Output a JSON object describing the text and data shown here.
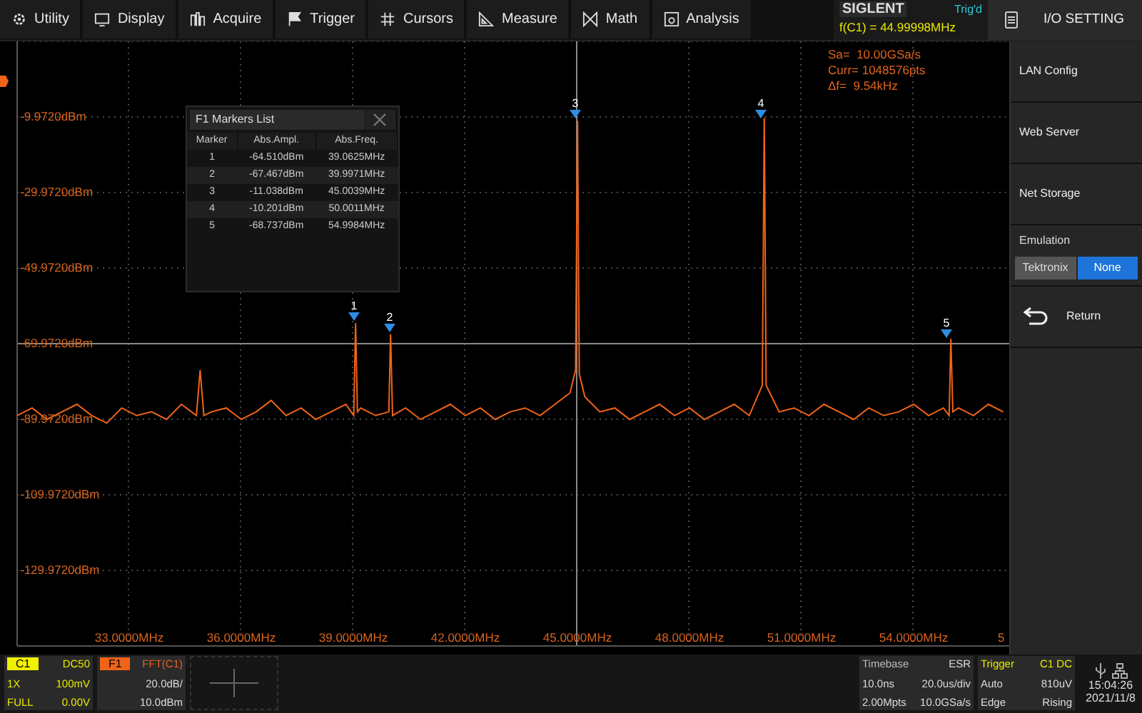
{
  "menu_bar": {
    "items": [
      {
        "label": "Utility"
      },
      {
        "label": "Display"
      },
      {
        "label": "Acquire"
      },
      {
        "label": "Trigger"
      },
      {
        "label": "Cursors"
      },
      {
        "label": "Measure"
      },
      {
        "label": "Math"
      },
      {
        "label": "Analysis"
      }
    ]
  },
  "header": {
    "brand": "SIGLENT",
    "trigger_status": "Trig'd",
    "frequency": "f(C1) = 44.99998MHz"
  },
  "plot": {
    "chart_data": {
      "type": "line",
      "grid": true,
      "xlim": [
        30,
        56.56
      ],
      "ylim": [
        -149.972,
        10.028
      ],
      "yticks": [
        {
          "value": -9.972,
          "label": "-9.9720dBm"
        },
        {
          "value": -29.972,
          "label": "-29.9720dBm"
        },
        {
          "value": -49.972,
          "label": "-49.9720dBm"
        },
        {
          "value": -69.972,
          "label": "-69.9720dBm"
        },
        {
          "value": -89.972,
          "label": "-89.9720dBm"
        },
        {
          "value": -109.972,
          "label": "-109.9720dBm"
        },
        {
          "value": -129.972,
          "label": "-129.9720dBm"
        }
      ],
      "xticks": [
        {
          "value": 33,
          "label": "33.0000MHz"
        },
        {
          "value": 36,
          "label": "36.0000MHz"
        },
        {
          "value": 39,
          "label": "39.0000MHz"
        },
        {
          "value": 42,
          "label": "42.0000MHz"
        },
        {
          "value": 45,
          "label": "45.0000MHz"
        },
        {
          "value": 48,
          "label": "48.0000MHz"
        },
        {
          "value": 51,
          "label": "51.0000MHz"
        },
        {
          "value": 54,
          "label": "54.0000MHz"
        }
      ],
      "x": [
        30.0,
        30.4,
        30.8,
        31.2,
        31.6,
        32.0,
        32.4,
        32.8,
        33.2,
        33.6,
        34.0,
        34.4,
        34.8,
        34.9,
        35.0,
        35.2,
        35.6,
        36.0,
        36.4,
        36.8,
        37.2,
        37.6,
        38.0,
        38.4,
        38.8,
        39.01,
        39.0625,
        39.11,
        39.2,
        39.6,
        39.95,
        39.9971,
        40.05,
        40.4,
        40.8,
        41.2,
        41.6,
        42.0,
        42.4,
        42.8,
        43.2,
        43.6,
        44.0,
        44.4,
        44.8,
        44.95,
        45.0039,
        45.05,
        45.2,
        45.6,
        46.0,
        46.4,
        46.8,
        47.2,
        47.6,
        48.0,
        48.4,
        48.8,
        49.2,
        49.6,
        49.95,
        50.0011,
        50.05,
        50.4,
        50.8,
        51.2,
        51.6,
        52.0,
        52.4,
        52.8,
        53.2,
        53.6,
        54.0,
        54.4,
        54.8,
        54.95,
        54.9984,
        55.05,
        55.2,
        55.6,
        56.0,
        56.4
      ],
      "series": [
        {
          "color": "#f06418",
          "values": [
            -89,
            -87,
            -90,
            -88,
            -86,
            -89,
            -91,
            -87,
            -89,
            -88,
            -90,
            -86,
            -89,
            -77,
            -89,
            -88,
            -87,
            -90,
            -88,
            -85,
            -89,
            -87,
            -90,
            -88,
            -86,
            -89,
            -64.5,
            -88,
            -87,
            -89,
            -88,
            -67.5,
            -89,
            -87,
            -90,
            -88,
            -86,
            -89,
            -87,
            -90,
            -88,
            -87,
            -89,
            -86,
            -83,
            -77,
            -11,
            -78,
            -84,
            -88,
            -87,
            -90,
            -88,
            -86,
            -89,
            -87,
            -90,
            -88,
            -86,
            -89,
            -81,
            -10.2,
            -81,
            -88,
            -87,
            -89,
            -86,
            -88,
            -90,
            -87,
            -89,
            -88,
            -86,
            -89,
            -87,
            -89,
            -68.7,
            -88,
            -87,
            -89,
            -86,
            -88
          ]
        }
      ]
    },
    "cut_x_label": "5",
    "readouts": [
      "Sa=  10.00GSa/s",
      "Curr= 1048576pts",
      "Δf=  9.54kHz"
    ],
    "markers": [
      {
        "label": "1"
      },
      {
        "label": "2"
      },
      {
        "label": "3"
      },
      {
        "label": "4"
      },
      {
        "label": "5"
      }
    ]
  },
  "markers_list": {
    "title": "F1 Markers List",
    "columns": [
      "Marker",
      "Abs.Ampl.",
      "Abs.Freq."
    ],
    "rows": [
      [
        "1",
        "-64.510dBm",
        "39.0625MHz"
      ],
      [
        "2",
        "-67.467dBm",
        "39.9971MHz"
      ],
      [
        "3",
        "-11.038dBm",
        "45.0039MHz"
      ],
      [
        "4",
        "-10.201dBm",
        "50.0011MHz"
      ],
      [
        "5",
        "-68.737dBm",
        "54.9984MHz"
      ]
    ]
  },
  "side_menu": {
    "title": "I/O SETTING",
    "items": [
      {
        "kind": "button",
        "label": "LAN Config"
      },
      {
        "kind": "button",
        "label": "Web Server"
      },
      {
        "kind": "button",
        "label": "Net Storage"
      },
      {
        "kind": "toggle",
        "label": "Emulation",
        "options": [
          {
            "label": "Tektronix",
            "selected": false
          },
          {
            "label": "None",
            "selected": true
          }
        ]
      },
      {
        "kind": "return",
        "label": "Return"
      }
    ]
  },
  "channels": [
    {
      "kind": "analog",
      "tag": "C1",
      "header": "DC50",
      "rows": [
        [
          "1X",
          "100mV"
        ],
        [
          "FULL",
          "0.00V"
        ]
      ]
    },
    {
      "kind": "math",
      "tag": "F1",
      "header": "FFT(C1)",
      "rows": [
        [
          "20.0dB/"
        ],
        [
          "10.0dBm"
        ]
      ]
    }
  ],
  "timebase": {
    "title": "Timebase",
    "mode": "ESR",
    "rows": [
      [
        "10.0ns",
        "20.0us/div"
      ],
      [
        "2.00Mpts",
        "10.0GSa/s"
      ]
    ]
  },
  "trigger": {
    "title": "Trigger",
    "source": "C1 DC",
    "rows": [
      [
        "Auto",
        "810uV"
      ],
      [
        "Edge",
        "Rising"
      ]
    ]
  },
  "status": {
    "time": "15:04:26",
    "date": "2021/11/8"
  }
}
